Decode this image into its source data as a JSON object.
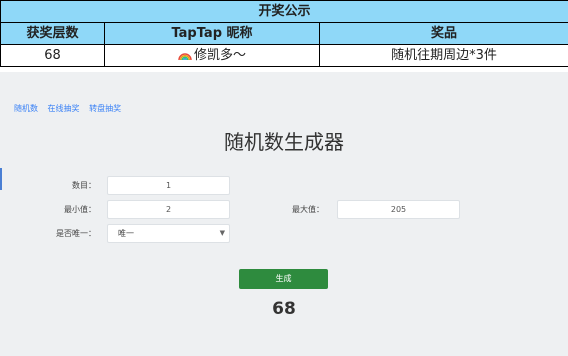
{
  "table": {
    "title": "开奖公示",
    "headers": [
      "获奖层数",
      "TapTap 昵称",
      "奖品"
    ],
    "row": {
      "floor": "68",
      "nickname": "修凯多～",
      "prize": "随机往期周边*3件"
    }
  },
  "nav": {
    "items": [
      "随机数",
      "在线抽奖",
      "转盘抽奖"
    ]
  },
  "generator": {
    "title": "随机数生成器",
    "count_label": "数目：",
    "count_value": "1",
    "min_label": "最小值：",
    "min_value": "2",
    "max_label": "最大值：",
    "max_value": "205",
    "unique_label": "是否唯一：",
    "unique_value": "唯一",
    "generate_label": "生成",
    "result": "68"
  },
  "colors": {
    "header_bg": "#8fd8f8",
    "button_bg": "#2e8b3e",
    "link": "#3b82f6"
  },
  "icons": {
    "nickname_prefix": "rainbow-icon",
    "select": "chevron-down-icon"
  }
}
